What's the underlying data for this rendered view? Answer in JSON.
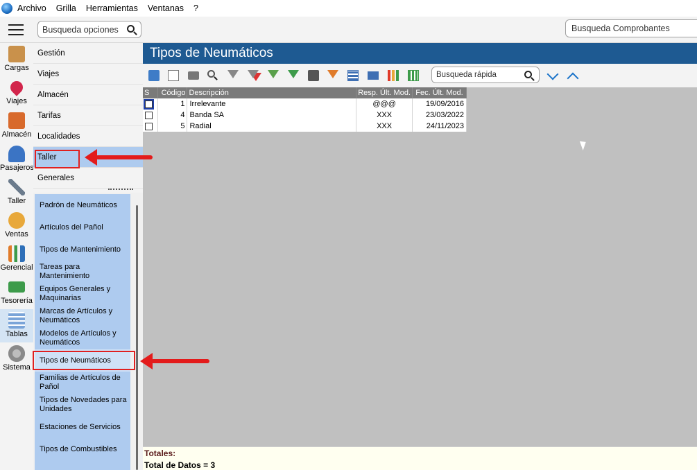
{
  "menubar": {
    "items": [
      "Archivo",
      "Grilla",
      "Herramientas",
      "Ventanas",
      "?"
    ]
  },
  "search": {
    "options_placeholder": "Busqueda opciones",
    "comprobantes_placeholder": "Busqueda Comprobantes"
  },
  "iconbar": {
    "items": [
      {
        "label": "Cargas",
        "icon": "box-icon",
        "color": "#c9914b"
      },
      {
        "label": "Viajes",
        "icon": "map-pin-icon",
        "color": "#d2254b"
      },
      {
        "label": "Almacén",
        "icon": "warehouse-icon",
        "color": "#d86a2c"
      },
      {
        "label": "Pasajeros",
        "icon": "passenger-icon",
        "color": "#3b74c4"
      },
      {
        "label": "Taller",
        "icon": "wrench-icon",
        "color": "#6b7b8c"
      },
      {
        "label": "Ventas",
        "icon": "sales-icon",
        "color": "#e8a83a"
      },
      {
        "label": "Gerencial",
        "icon": "chart-icon",
        "color": "#e07b2a"
      },
      {
        "label": "Tesorería",
        "icon": "money-icon",
        "color": "#3d9b4a"
      },
      {
        "label": "Tablas",
        "icon": "table-icon",
        "color": "#7aa4d8"
      },
      {
        "label": "Sistema",
        "icon": "gear-icon",
        "color": "#8a8a8a"
      }
    ],
    "active": "Tablas"
  },
  "menucol": {
    "items": [
      "Gestión",
      "Viajes",
      "Almacén",
      "Tarifas",
      "Localidades",
      "Taller",
      "Generales"
    ],
    "selected": "Taller"
  },
  "submenu": {
    "items": [
      "Padrón de Neumáticos",
      "Artículos del Pañol",
      "Tipos de Mantenimiento",
      "Tareas para Mantenimiento",
      "Equipos Generales y Maquinarias",
      "Marcas de Artículos y Neumáticos",
      "Modelos de Artículos y Neumáticos",
      "Tipos de Neumáticos",
      "Familias de Artículos de Pañol",
      "Tipos de Novedades para Unidades",
      "Estaciones de Servicios",
      "Tipos de Combustibles"
    ],
    "current": "Tipos de Neumáticos"
  },
  "main": {
    "title": "Tipos de Neumáticos",
    "quick_search_placeholder": "Busqueda rápida",
    "columns": [
      "S",
      "Código",
      "Descripción",
      "Resp. Últ. Mod.",
      "Fec. Últ. Mod."
    ],
    "rows": [
      {
        "codigo": "1",
        "descripcion": "Irrelevante",
        "resp": "@@@",
        "fecha": "19/09/2016"
      },
      {
        "codigo": "4",
        "descripcion": "Banda SA",
        "resp": "XXX",
        "fecha": "23/03/2022"
      },
      {
        "codigo": "5",
        "descripcion": "Radial",
        "resp": "XXX",
        "fecha": "24/11/2023"
      }
    ],
    "totals_label": "Totales:",
    "total_count": "Total de Datos = 3"
  },
  "colors": {
    "title_bar": "#1e5a92",
    "menu_selected": "#aecbef",
    "annotation": "#e31b1b"
  }
}
